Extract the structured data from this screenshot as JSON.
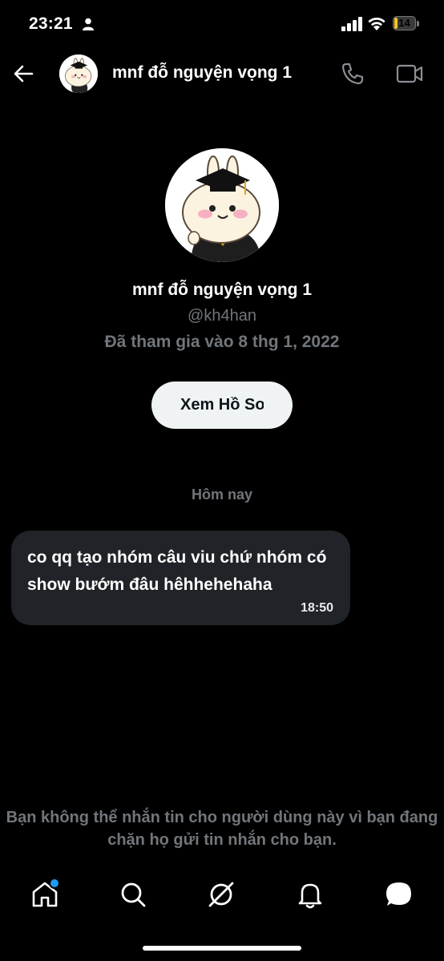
{
  "status_bar": {
    "time": "23:21",
    "battery_level": "14",
    "battery_fraction": 0.14,
    "battery_color": "#f5c425"
  },
  "header": {
    "name": "mnf đỗ nguyện vọng 1",
    "icons": [
      "back-arrow-icon",
      "phone-icon",
      "video-camera-icon"
    ]
  },
  "profile": {
    "name": "mnf đỗ nguyện vọng 1",
    "handle": "@kh4han",
    "joined": "Đã tham gia vào 8 thg 1, 2022",
    "view_profile_label": "Xem Hồ Sơ"
  },
  "conversation": {
    "date_separator": "Hôm nay",
    "messages": [
      {
        "text": "co qq tạo nhóm câu viu chứ nhóm có show bướm đâu hêhhehehaha",
        "time": "18:50"
      }
    ]
  },
  "blocked_notice": "Bạn không thể nhắn tin cho người dùng này vì bạn đang chặn họ gửi tin nhắn cho bạn.",
  "bottom_nav": {
    "items": [
      "home-icon",
      "search-icon",
      "grok-icon",
      "bell-icon",
      "messages-icon"
    ],
    "accent_color": "#1d9bf0"
  }
}
